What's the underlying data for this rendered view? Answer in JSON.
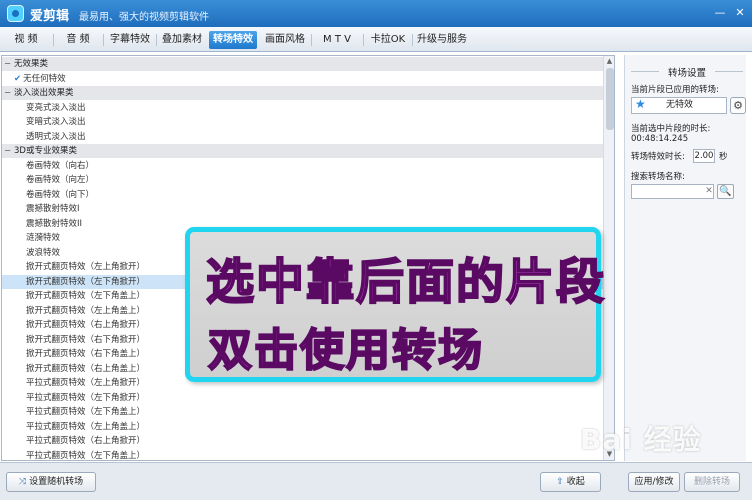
{
  "app": {
    "title": "爱剪辑",
    "subtitle": "最易用、强大的视频剪辑软件"
  },
  "tabs": [
    "视 频",
    "音 频",
    "字幕特效",
    "叠加素材",
    "转场特效",
    "画面风格",
    "M T V",
    "卡拉OK",
    "升级与服务"
  ],
  "active_tab": "转场特效",
  "list": {
    "rows": [
      {
        "type": "group",
        "marker": "−",
        "label": "无效果类"
      },
      {
        "type": "noeffect",
        "label": "无任何特效",
        "checked": true
      },
      {
        "type": "group",
        "marker": "−",
        "label": "淡入淡出效果类"
      },
      {
        "type": "item",
        "label": "变亮式淡入淡出"
      },
      {
        "type": "item",
        "label": "变暗式淡入淡出"
      },
      {
        "type": "item",
        "label": "透明式淡入淡出"
      },
      {
        "type": "group",
        "marker": "−",
        "label": "3D或专业效果类"
      },
      {
        "type": "item",
        "label": "卷画特效（向右）"
      },
      {
        "type": "item",
        "label": "卷画特效（向左）"
      },
      {
        "type": "item",
        "label": "卷画特效（向下）"
      },
      {
        "type": "item",
        "label": "震撼散射特效I"
      },
      {
        "type": "item",
        "label": "震撼散射特效II"
      },
      {
        "type": "item",
        "label": "涟漪特效"
      },
      {
        "type": "item",
        "label": "波浪特效"
      },
      {
        "type": "item",
        "label": "掀开式翻页特效（左上角掀开）"
      },
      {
        "type": "item",
        "label": "掀开式翻页特效（左下角掀开）",
        "selected": true
      },
      {
        "type": "item",
        "label": "掀开式翻页特效（左下角盖上）"
      },
      {
        "type": "item",
        "label": "掀开式翻页特效（左上角盖上）"
      },
      {
        "type": "item",
        "label": "掀开式翻页特效（右上角掀开）"
      },
      {
        "type": "item",
        "label": "掀开式翻页特效（右下角掀开）"
      },
      {
        "type": "item",
        "label": "掀开式翻页特效（右下角盖上）"
      },
      {
        "type": "item",
        "label": "掀开式翻页特效（右上角盖上）"
      },
      {
        "type": "item",
        "label": "平拉式翻页特效（左上角掀开）"
      },
      {
        "type": "item",
        "label": "平拉式翻页特效（左下角掀开）"
      },
      {
        "type": "item",
        "label": "平拉式翻页特效（左下角盖上）"
      },
      {
        "type": "item",
        "label": "平拉式翻页特效（左上角盖上）"
      },
      {
        "type": "item",
        "label": "平拉式翻页特效（右上角掀开）"
      },
      {
        "type": "item",
        "label": "平拉式翻页特效（左下角盖上）"
      }
    ]
  },
  "callout": {
    "line1": "选中靠后面的片段",
    "line2": "双击使用转场"
  },
  "settings": {
    "title": "转场设置",
    "applied_label": "当前片段已应用的转场:",
    "applied_value": "无特效",
    "clip_duration_label": "当前选中片段的时长:",
    "clip_duration_value": "00:48:14.245",
    "effect_duration_label": "转场特效时长:",
    "effect_duration_value": "2.00",
    "effect_duration_unit": "秒",
    "search_label": "搜索转场名称:",
    "search_value": ""
  },
  "bottom": {
    "random_button": "设置随机转场",
    "collapse_button": "收起",
    "apply_button": "应用/修改",
    "delete_button": "删除转场"
  },
  "watermark": "Bai 经验",
  "icons": {
    "random": "shuffle-icon",
    "collapse": "arrow-up-icon",
    "search": "search-icon",
    "gear": "gear-icon",
    "star": "star-icon"
  }
}
